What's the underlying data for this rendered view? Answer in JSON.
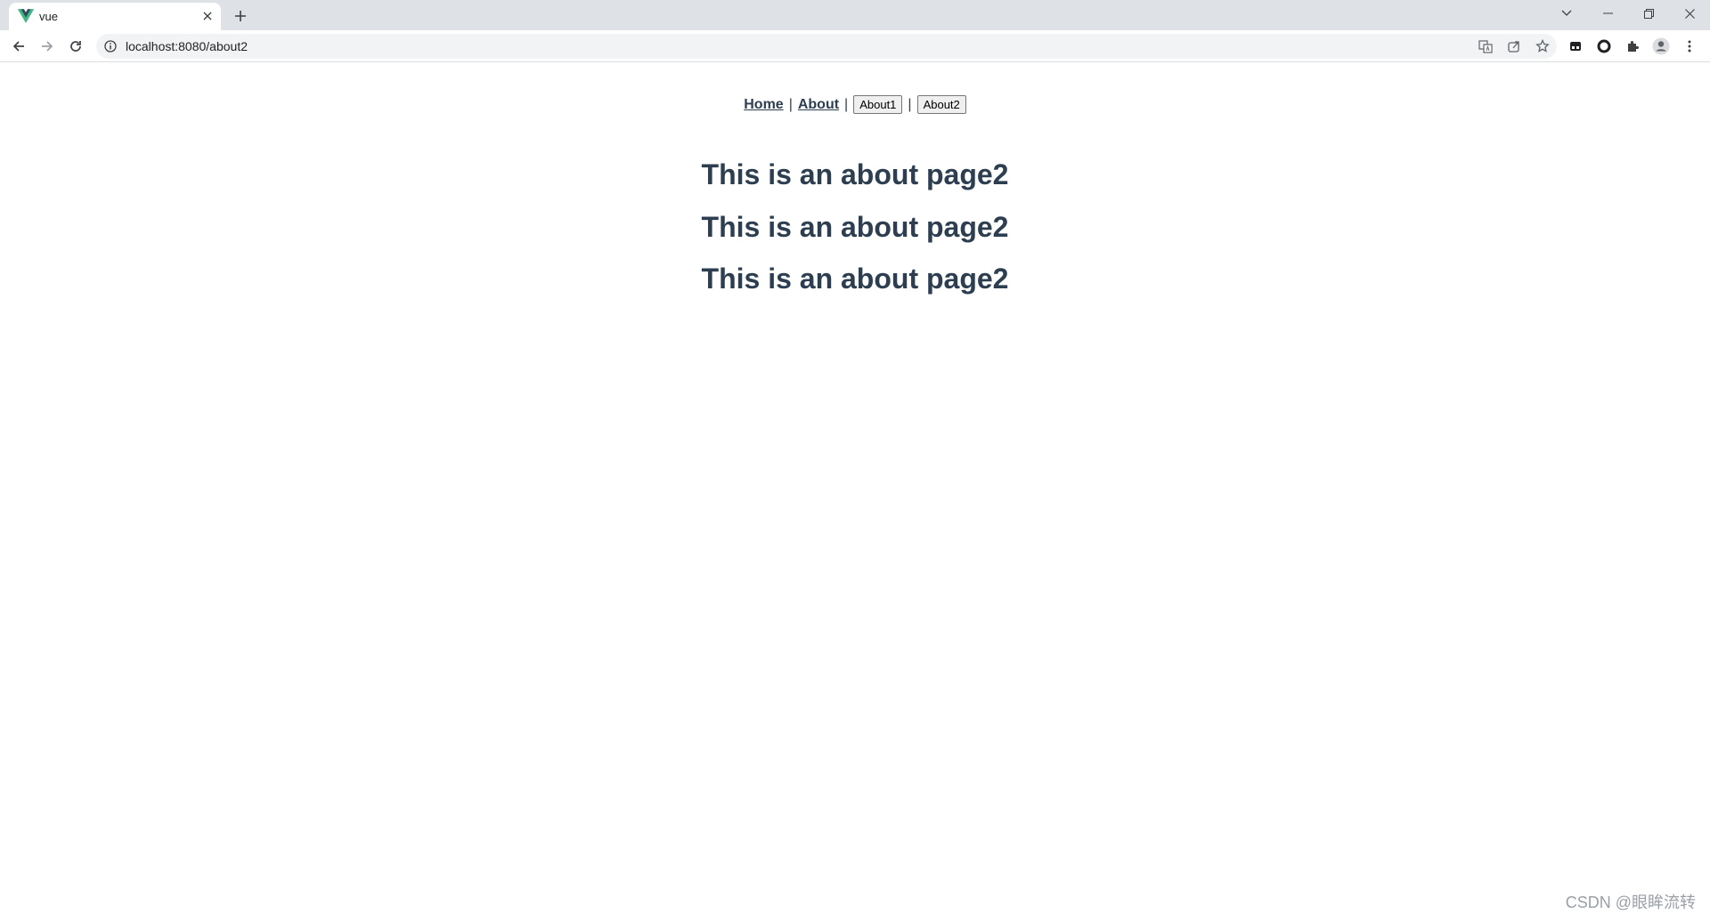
{
  "browser": {
    "tab": {
      "title": "vue",
      "favicon": "vue-logo-icon",
      "close_icon": "close-icon"
    },
    "new_tab_icon": "plus-icon",
    "window_controls": [
      "chevron-down-icon",
      "minimize-icon",
      "restore-icon",
      "close-icon"
    ],
    "address_bar": {
      "url": "localhost:8080/about2",
      "info_icon": "info-icon"
    },
    "toolbar_icons": [
      "back-arrow-icon",
      "forward-arrow-icon",
      "reload-icon"
    ],
    "omnibox_icons": [
      "translate-icon",
      "share-icon",
      "star-icon"
    ],
    "extension_icons": [
      "extension-icon",
      "record-icon",
      "puzzle-icon",
      "profile-icon",
      "kebab-menu-icon"
    ]
  },
  "page": {
    "nav": {
      "home": "Home",
      "sep1": "|",
      "about": "About",
      "sep2": "|",
      "about1_button": "About1",
      "sep3": "|",
      "about2_button": "About2"
    },
    "headings": [
      "This is an about page2",
      "This is an about page2",
      "This is an about page2"
    ],
    "colors": {
      "text": "#2c3e50",
      "vue_green": "#41b883",
      "vue_dark": "#34495e"
    }
  },
  "watermark": "CSDN @眼眸流转"
}
